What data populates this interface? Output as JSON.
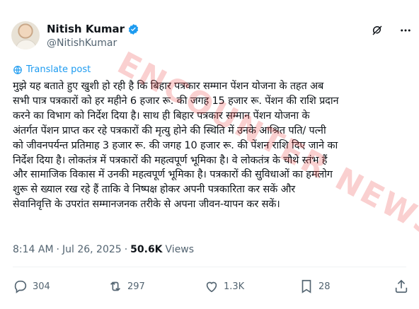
{
  "top_clip": "••••",
  "author": {
    "name": "Nitish Kumar",
    "handle": "@NitishKumar"
  },
  "translate_label": "Translate post",
  "post_text": "मुझे यह बताते हुए खुशी हो रही है कि बिहार पत्रकार सम्मान पेंशन योजना के तहत अब\nसभी पात्र पत्रकारों को हर महीने 6 हजार रू. की जगह 15 हजार रू. पेंशन की राशि प्रदान\nकरने का विभाग को निर्देश दिया है। साथ ही बिहार पत्रकार सम्मान पेंशन योजना के\nअंतर्गत पेंशन प्राप्त कर रहे पत्रकारों की मृत्यु होने की स्थिति में उनके आश्रित पति/ पत्नी\nको जीवनपर्यन्त प्रतिमाह 3 हजार रू. की जगह 10 हजार रू. की पेंशन राशि दिए जाने का\nनिर्देश दिया है। लोकतंत्र में पत्रकारों की महत्वपूर्ण भूमिका है। वे लोकतंत्र के चौथे स्तंभ हैं\nऔर सामाजिक विकास में उनकी महत्वपूर्ण भूमिका है। पत्रकारों की सुविधाओं का हमलोग\nशुरू से ख्याल रख रहे हैं ताकि वे निष्पक्ष होकर अपनी पत्रकारिता कर सकें और\nसेवानिवृत्ति के उपरांत सम्मानजनक तरीके से अपना जीवन-यापन कर सकें।",
  "watermark": "ENCOUNTER NEWS",
  "meta": {
    "time": "8:14 AM",
    "separator": "·",
    "date": "Jul 26, 2025",
    "views_count": "50.6K",
    "views_label": "Views"
  },
  "actions": {
    "replies": "304",
    "reposts": "297",
    "likes": "1.3K",
    "bookmarks": "28"
  },
  "colors": {
    "accent": "#1d9bf0",
    "muted": "#536471",
    "text": "#0f1419"
  },
  "icons": [
    "verified-badge-icon",
    "grok-icon",
    "more-icon",
    "translate-icon",
    "reply-icon",
    "repost-icon",
    "like-icon",
    "bookmark-icon",
    "share-icon"
  ]
}
